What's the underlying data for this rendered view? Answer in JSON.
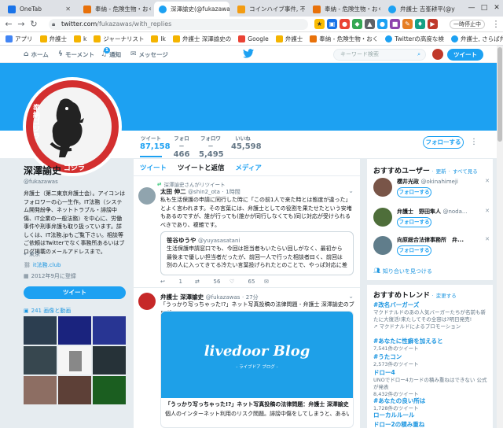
{
  "browser": {
    "tabs": [
      {
        "title": "OneTab",
        "color": "#1a73e8"
      },
      {
        "title": "奉納 - 危険生物・おく",
        "color": "#e8710a"
      },
      {
        "title": "深澤諭史(@fukazawa",
        "color": "#1da1f2"
      },
      {
        "title": "コインハイブ事件, 不",
        "color": "#f39c12"
      },
      {
        "title": "奉納 - 危険生物・おく",
        "color": "#e8710a"
      },
      {
        "title": "弁護士 吉峯耕平(@y",
        "color": "#1da1f2"
      }
    ],
    "url_host": "twitter.com",
    "url_path": "/fukazawas/with_replies",
    "pause_label": "一時停止中",
    "window_controls": [
      "—",
      "□",
      "✕"
    ],
    "bookmarks": [
      {
        "label": "アプリ",
        "color": "#4285f4"
      },
      {
        "label": "弁護士",
        "color": "#f4b400"
      },
      {
        "label": "k",
        "color": "#f4b400"
      },
      {
        "label": "ジャーナリスト",
        "color": "#f4b400"
      },
      {
        "label": "lk",
        "color": "#f4b400"
      },
      {
        "label": "弁護士 深澤諭史の",
        "color": "#f4b400"
      },
      {
        "label": "Google",
        "color": "#ea4335"
      },
      {
        "label": "弁護士",
        "color": "#f4b400"
      },
      {
        "label": "奉納 - 危険生物・おく",
        "color": "#e8710a"
      },
      {
        "label": "Twitterの高度な検",
        "color": "#1da1f2"
      },
      {
        "label": "弁護士, さらば弁護士",
        "color": "#1da1f2"
      }
    ]
  },
  "twitter_nav": {
    "home": "ホーム",
    "moments": "モーメント",
    "notifications": "通知",
    "notification_count": "1",
    "messages": "メッセージ",
    "search_placeholder": "キーワード検索",
    "tweet_button": "ツイート"
  },
  "profile": {
    "name": "深澤諭史",
    "handle": "@fukazawas",
    "bio": "弁護士（第二東京弁護士会）。アイコンはフォロワーの心一生作。IT法務（システム開発紛争、ネットトラブル・誹謗中傷、IT企業の一般法務）を中心に、労働事件や刑事弁護も取り扱っています。詳しくは、IT法務.jpもご覧下さい。相談等ご依頼はTwitterでなく事務所あるいはブログ掲載のメールアドレスまで。",
    "location": "東京",
    "website": "it法務.club",
    "joined": "2012年9月に登録",
    "tweet_button": "ツイート",
    "media_label": "241 画像と動画",
    "avatar_text": "奉納ゴジラ",
    "avatar_bottom": "ゴジラ"
  },
  "stats": [
    {
      "label": "ツイート",
      "value": "87,158"
    },
    {
      "label": "フォロー",
      "value": "466"
    },
    {
      "label": "フォロワー",
      "value": "5,495"
    },
    {
      "label": "いいね",
      "value": "45,598"
    }
  ],
  "follow_button": "フォローする",
  "timeline": {
    "tabs": [
      "ツイート",
      "ツイートと返信",
      "メディア"
    ],
    "tweets": [
      {
        "retweet_by": "深澤諭史さんがリツイート",
        "name": "太田 伸二",
        "handle": "@shin2_ota",
        "time": "1時間",
        "text": "私も生活保護の申請に同行した時に「この前1人で来た時とは態度が違った」とよく言われます。その言葉には、弁護士としての役割を果たせたという安堵もあるのですが、誰が行っても(誰かが同行しなくても)同じ対応が受けられるべきであり、複雑です。",
        "quote_name": "笹谷ゆうや",
        "quote_handle": "@yuyasasatani",
        "quote_text": "生活保護申請窓口でも、今回は担当者もいたらい回しがなく、最初から最後まで優しい担当者だったが、前回一人で行った相談者曰く、前回は別の人に入ってきてる冷たい言葉投げられたとのことで、やっぱ対応に差があるのかもしれない。",
        "replies": "1",
        "retweets": "56",
        "likes": "65"
      },
      {
        "name": "弁護士 深澤諭史",
        "handle": "@fukazawas",
        "time": "27分",
        "text": "「うっかり写っちゃった!?」ネット写真投稿の法律問題 - 弁護士 深澤諭史のブログ",
        "card_logo": "livedoor Blog",
        "card_tag": "- ライブドア ブログ -",
        "card_title": "「うっかり写っちゃった!?」ネット写真投稿の法律問題：弁護士 深澤諭史のブログ",
        "card_desc": "個人のインターネット利用のリスク問題。誹謗中傷をしてしまうと、あるいはされてしまう。"
      }
    ]
  },
  "who_to_follow": {
    "title": "おすすめユーザー",
    "refresh": "更新",
    "view_all": "すべて見る",
    "follow_label": "フォローする",
    "users": [
      {
        "name": "櫻井光政",
        "handle": "@okinahimeji"
      },
      {
        "name": "弁護士　野田隼人",
        "handle": "@noda..."
      },
      {
        "name": "向原総合法律事務所　弁...",
        "handle": ""
      }
    ],
    "find_friends": "知り合いを見つける"
  },
  "trends": {
    "title": "おすすめトレンド",
    "change": "変更する",
    "items": [
      {
        "tag": "#改名バーガーズ",
        "desc": "マクドナルドのあの人気バーガーたちが名前も新たに大復活!来たしてその全容は?明日発売!",
        "promo": "マクドナルドによるプロモーション"
      },
      {
        "tag": "#あなたに性癖を加えると",
        "desc": "7,541件のツイート"
      },
      {
        "tag": "#うたコン",
        "desc": "2,573件のツイート"
      },
      {
        "tag": "ドロー4",
        "desc": "UNOでドロー4カードの積み重ねはできない 公式が発表",
        "extra": "8,432件のツイート"
      },
      {
        "tag": "#あなたの良い所は",
        "desc": "1,728件のツイート"
      },
      {
        "tag": "ローカルルール",
        "desc": ""
      },
      {
        "tag": "ドロー2の積み重ね",
        "desc": ""
      }
    ]
  }
}
